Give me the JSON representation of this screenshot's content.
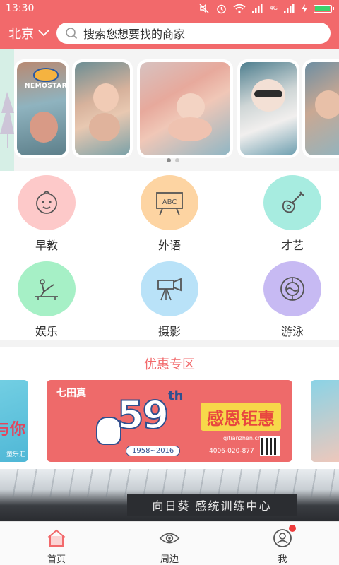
{
  "status_bar": {
    "time": "13:30",
    "network_label": "4G",
    "icons": [
      "mute-icon",
      "alarm-icon",
      "wifi-icon",
      "signal-icon",
      "signal-4g-icon",
      "charging-icon",
      "battery-icon"
    ],
    "battery_level": 0.95
  },
  "header": {
    "city": "北京",
    "search_placeholder": "搜索您想要找的商家"
  },
  "banner": {
    "logo_text": "NEMOSTAR",
    "slide_count": 2,
    "active_slide": 1
  },
  "categories": [
    {
      "label": "早教",
      "icon": "baby-face-icon",
      "color": "#fdc9c9"
    },
    {
      "label": "外语",
      "icon": "abc-board-icon",
      "color": "#fdd4a2"
    },
    {
      "label": "才艺",
      "icon": "guitar-icon",
      "color": "#a7ece0"
    },
    {
      "label": "娱乐",
      "icon": "gymnast-icon",
      "color": "#a6f0c6"
    },
    {
      "label": "摄影",
      "icon": "camera-icon",
      "color": "#b9e2f8"
    },
    {
      "label": "游泳",
      "icon": "swim-ring-icon",
      "color": "#c7baf3"
    }
  ],
  "deals": {
    "title": "优惠专区",
    "left_card_text": "与你",
    "left_card_small": "童乐汇",
    "main": {
      "brand": "七田真",
      "number": "59",
      "superscript": "th",
      "years": "1958~2016",
      "headline": "感恩钜惠",
      "url": "qitianzhen.cn",
      "phone": "4006-020-877"
    }
  },
  "building": {
    "sign": "向日葵 感统训练中心"
  },
  "tabbar": {
    "tabs": [
      {
        "label": "首页",
        "icon": "home-icon",
        "active": true
      },
      {
        "label": "周边",
        "icon": "eye-icon",
        "active": false
      },
      {
        "label": "我",
        "icon": "user-icon",
        "active": false
      }
    ],
    "accent": "#f2696b"
  }
}
